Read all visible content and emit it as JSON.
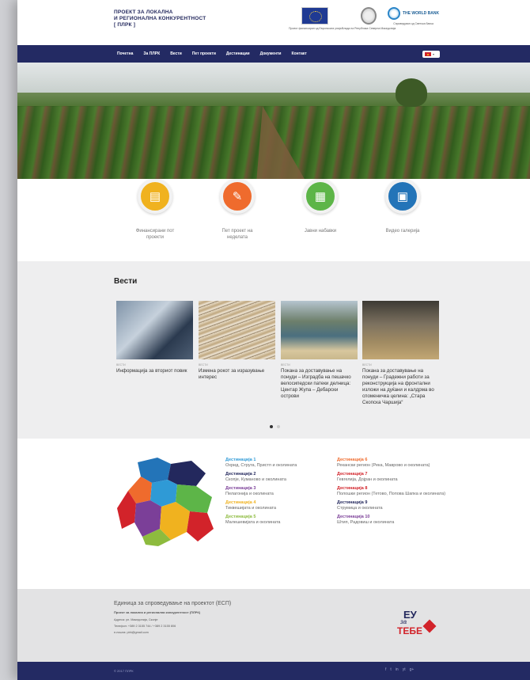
{
  "header": {
    "logo_lines": [
      "ПРОЕКТ ЗА ЛОКАЛНА",
      "И РЕГИОНАЛНА КОНКУРЕНТНОСТ",
      "[ ПЛРК ]"
    ],
    "partners": [
      {
        "icon": "eu-flag-icon",
        "caption": "Проект финансиран од Европската унија"
      },
      {
        "icon": "government-seal-icon",
        "caption": "Влада на Република Северна Македонија"
      },
      {
        "icon": "world-bank-icon",
        "name": "THE WORLD BANK",
        "caption": "Спроведуван од Светска банка"
      }
    ]
  },
  "nav": {
    "items": [
      "Почетна",
      "За ПЛРК",
      "Вести",
      "Пет проекти",
      "Дестинации",
      "Документи",
      "Контакт"
    ],
    "language": "mk"
  },
  "tiles": [
    {
      "label": "Финансирани пот проекти",
      "icon": "document-icon",
      "color": "#f0b21f"
    },
    {
      "label": "Пет проект на неделата",
      "icon": "report-icon",
      "color": "#ef6b2d"
    },
    {
      "label": "Јавни набавки",
      "icon": "building-icon",
      "color": "#5db548"
    },
    {
      "label": "Видео галерија",
      "icon": "video-icon",
      "color": "#2374b8"
    }
  ],
  "news": {
    "title": "Вести",
    "items": [
      {
        "meta": "вести",
        "title": "Информација за вториот повик"
      },
      {
        "meta": "вести",
        "title": "Измена рокот за изразување интерес"
      },
      {
        "meta": "вести",
        "title": "Покана за доставување на понуди – Изградба на пешачко велосипедски патеки делница: Центар Жупа – Дебарски острови"
      },
      {
        "meta": "вести",
        "title": "Покана за доставување на понуди – Градежни работи за реконструкција на фронтални изложи на дуќани и калдрма во споменичка целина: „Стара Скопска Чаршија“"
      }
    ]
  },
  "destinations": {
    "left": [
      {
        "name": "Дестинација 1",
        "desc": "Охрид, Струга, Пристп и околината",
        "color": "#2f9ad6"
      },
      {
        "name": "Дестинација 2",
        "desc": "Скопје, Куманово и околината",
        "color": "#23285d"
      },
      {
        "name": "Дестинација 3",
        "desc": "Пелагонија и околината",
        "color": "#7b3f98"
      },
      {
        "name": "Дестинација 4",
        "desc": "Тиквешијата и околината",
        "color": "#f0b21f"
      },
      {
        "name": "Дестинација 5",
        "desc": "Малешевијата и околината",
        "color": "#8dbb3e"
      }
    ],
    "right": [
      {
        "name": "Дестинација 6",
        "desc": "Рекански регион (Река, Маврово и околината)",
        "color": "#ef6b2d"
      },
      {
        "name": "Дестинација 7",
        "desc": "Гевгелија, Дојран и околината",
        "color": "#d2232a"
      },
      {
        "name": "Дестинација 8",
        "desc": "Полошки регион (Тетово, Попова Шапка и околината)",
        "color": "#d2232a"
      },
      {
        "name": "Дестинација 9",
        "desc": "Струмица и околината",
        "color": "#23285d"
      },
      {
        "name": "Дестинација 10",
        "desc": "Штип, Радовиш и околината",
        "color": "#7b3f98"
      }
    ]
  },
  "footer": {
    "title": "Единица за спроведување на проектот (ЕСП)",
    "subtitle": "Проект за локална и регионална конкурентност (ПЛРК)",
    "address": "Адреса: ул. Македонија, Скопје",
    "phone": "Телефон: +389 2 3155 744 / +389 2 3155 806",
    "email": "e-пошта: plrk@gmail.com",
    "logo_lines": [
      "ЕУ",
      "за",
      "ТЕБЕ"
    ],
    "copyright": "© 2017 ПЛРК",
    "social": [
      "f",
      "t",
      "in",
      "yt",
      "g+"
    ]
  }
}
